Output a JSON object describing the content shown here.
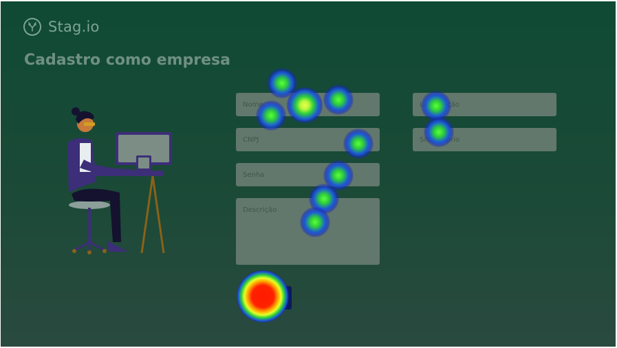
{
  "brand": {
    "name": "Stag.io",
    "logo_icon": "deer-icon"
  },
  "page": {
    "title": "Cadastro como empresa"
  },
  "form": {
    "fields": {
      "nome": {
        "placeholder": "Nome"
      },
      "cnpj": {
        "placeholder": "CNPJ"
      },
      "senha": {
        "placeholder": "Senha"
      },
      "descricao": {
        "placeholder": "Descrição"
      },
      "localizacao": {
        "placeholder": "Localização"
      },
      "site": {
        "placeholder": "Site próprio"
      }
    },
    "submit_label": ""
  },
  "illustration": {
    "icon": "person-at-computer-icon"
  },
  "colors": {
    "background_top": "#0f4a35",
    "background_bottom": "#2a4a3f",
    "field_bg": "#62786c",
    "button_bg": "#0b1a5a"
  }
}
